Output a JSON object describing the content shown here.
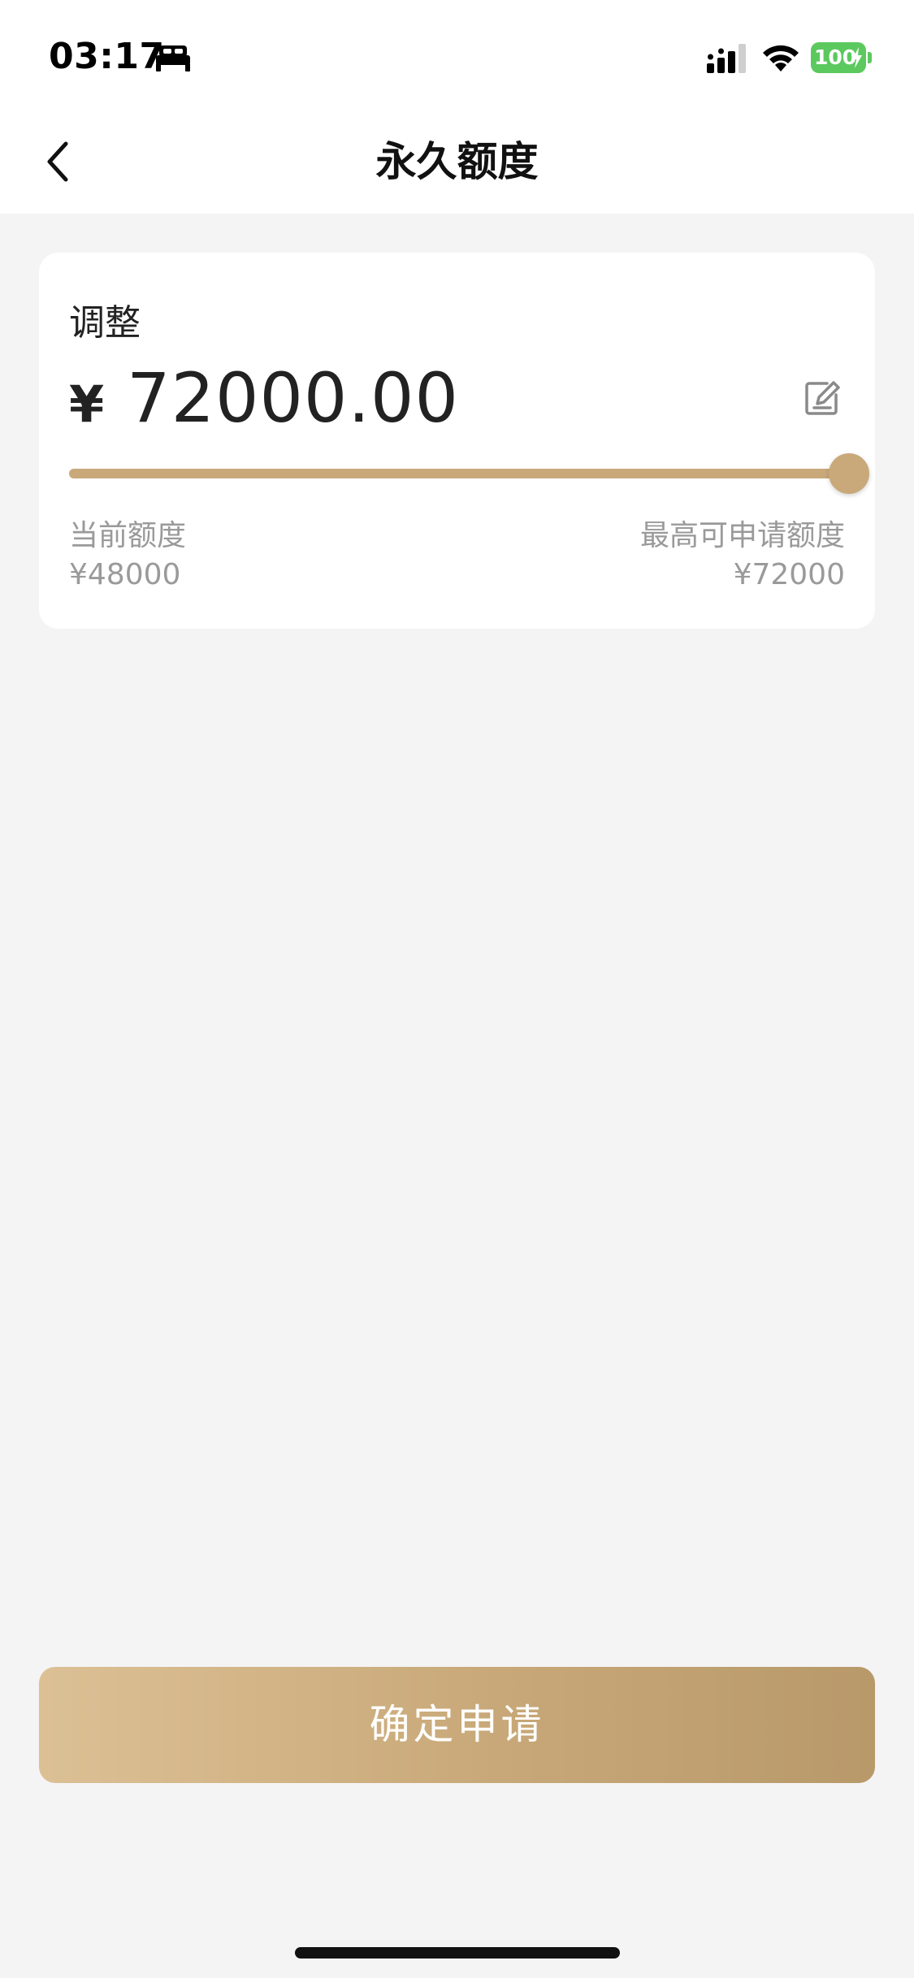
{
  "status_bar": {
    "time": "03:17",
    "battery": "100",
    "icons": [
      "sleep-mode-icon",
      "signal-icon",
      "wifi-icon",
      "battery-charging-icon"
    ]
  },
  "nav": {
    "title": "永久额度",
    "back_icon": "chevron-left-icon"
  },
  "card": {
    "label": "调整",
    "currency": "¥",
    "amount": "72000.00",
    "edit_icon": "edit-icon",
    "slider": {
      "value": 72000,
      "min": 48000,
      "max": 72000,
      "fill_fraction": 1.0
    },
    "current_limit_label": "当前额度",
    "current_limit_value": "¥48000",
    "max_limit_label": "最高可申请额度",
    "max_limit_value": "¥72000"
  },
  "submit": {
    "label": "确定申请"
  },
  "colors": {
    "accent": "#c9a87a",
    "background": "#f4f4f4",
    "battery_green": "#5bc95e"
  }
}
